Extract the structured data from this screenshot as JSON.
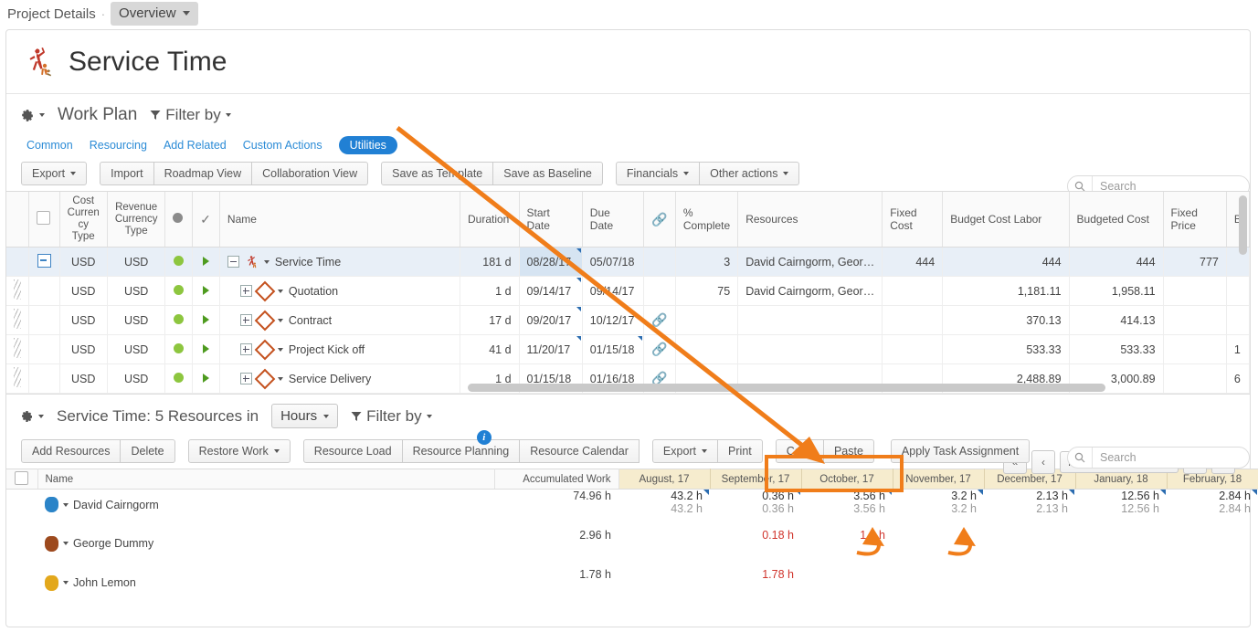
{
  "breadcrumb": {
    "root": "Project Details",
    "sep": "·",
    "current": "Overview"
  },
  "page_title": "Service Time",
  "workplan": {
    "title": "Work Plan",
    "filter_label": "Filter by",
    "tabs": [
      {
        "label": "Common",
        "selected": false
      },
      {
        "label": "Resourcing",
        "selected": false
      },
      {
        "label": "Add Related",
        "selected": false
      },
      {
        "label": "Custom Actions",
        "selected": false
      },
      {
        "label": "Utilities",
        "selected": true
      }
    ],
    "buttons_group1": [
      "Export"
    ],
    "buttons_group2": [
      "Import",
      "Roadmap View",
      "Collaboration View"
    ],
    "buttons_group3": [
      "Save as Template",
      "Save as Baseline"
    ],
    "buttons_group4": [
      "Financials",
      "Other actions"
    ],
    "search_placeholder": "Search",
    "search_value": ""
  },
  "grid": {
    "columns": [
      "Cost Currency Type",
      "Revenue Currency Type",
      "Name",
      "Duration",
      "Start Date",
      "Due Date",
      "% Complete",
      "Resources",
      "Fixed Cost",
      "Budget Cost Labor",
      "Budgeted Cost",
      "Fixed Price"
    ],
    "col_cost_line1": "Cost",
    "col_cost_line2": "Curren",
    "col_cost_line3": "cy",
    "col_cost_line4": "Type",
    "col_rev_line1": "Revenue",
    "col_rev_line2": "Currency",
    "col_rev_line3": "Type",
    "rows": [
      {
        "cost_currency": "USD",
        "revenue_currency": "USD",
        "name": "Service Time",
        "icon": "runner-icon",
        "expander": "minus",
        "duration": "181 d",
        "start_date": "08/28/17",
        "due_date": "05/07/18",
        "link": false,
        "percent_complete": "3",
        "resources": "David Cairngorm, Geor…",
        "fixed_cost": "444",
        "budget_cost_labor": "444",
        "budgeted_cost": "444",
        "fixed_price": "777",
        "selected": true
      },
      {
        "cost_currency": "USD",
        "revenue_currency": "USD",
        "name": "Quotation",
        "icon": "diamond-icon",
        "expander": "plus",
        "duration": "1 d",
        "start_date": "09/14/17",
        "due_date": "09/14/17",
        "link": false,
        "percent_complete": "75",
        "resources": "David Cairngorm, Geor…",
        "fixed_cost": "",
        "budget_cost_labor": "1,181.11",
        "budgeted_cost": "1,958.11",
        "fixed_price": "",
        "selected": false
      },
      {
        "cost_currency": "USD",
        "revenue_currency": "USD",
        "name": "Contract",
        "icon": "diamond-icon",
        "expander": "plus",
        "duration": "17 d",
        "start_date": "09/20/17",
        "due_date": "10/12/17",
        "link": true,
        "percent_complete": "",
        "resources": "",
        "fixed_cost": "",
        "budget_cost_labor": "370.13",
        "budgeted_cost": "414.13",
        "fixed_price": "",
        "selected": false
      },
      {
        "cost_currency": "USD",
        "revenue_currency": "USD",
        "name": "Project Kick off",
        "icon": "diamond-icon",
        "expander": "plus",
        "duration": "41 d",
        "start_date": "11/20/17",
        "due_date": "01/15/18",
        "link": true,
        "percent_complete": "",
        "resources": "",
        "fixed_cost": "",
        "budget_cost_labor": "533.33",
        "budgeted_cost": "533.33",
        "fixed_price": "",
        "selected": false
      },
      {
        "cost_currency": "USD",
        "revenue_currency": "USD",
        "name": "Service Delivery",
        "icon": "diamond-icon",
        "expander": "plus",
        "duration": "1 d",
        "start_date": "01/15/18",
        "due_date": "01/16/18",
        "link": true,
        "percent_complete": "",
        "resources": "",
        "fixed_cost": "",
        "budget_cost_labor": "2,488.89",
        "budgeted_cost": "3,000.89",
        "fixed_price": "",
        "selected": false
      }
    ]
  },
  "resources": {
    "title": "Service Time: 5 Resources in",
    "unit": "Hours",
    "filter_label": "Filter by",
    "nav_first": "«",
    "nav_prev": "‹",
    "nav_next": "›",
    "nav_last": "»",
    "scale": "Month",
    "buttons_group1": [
      "Add Resources",
      "Delete"
    ],
    "buttons_group2": [
      "Restore Work"
    ],
    "buttons_group3": [
      "Resource Load",
      "Resource Planning",
      "Resource Calendar"
    ],
    "buttons_group4": [
      "Export",
      "Print"
    ],
    "buttons_group5": [
      "Copy",
      "Paste"
    ],
    "highlighted_button": "Apply Task Assignment",
    "search_placeholder": "Search",
    "search_value": "",
    "col_name": "Name",
    "col_accumulated": "Accumulated Work",
    "months": [
      "August, 17",
      "September, 17",
      "October, 17",
      "November, 17",
      "December, 17",
      "January, 18",
      "February, 18"
    ],
    "rows": [
      {
        "name": "David Cairngorm",
        "avatar_color": "#2b84c8",
        "accumulated": "74.96 h",
        "cells": [
          {
            "top": "43.2 h",
            "bottom": "43.2 h",
            "style": "normal"
          },
          {
            "top": "0.36 h",
            "bottom": "0.36 h",
            "style": "normal"
          },
          {
            "top": "3.56 h",
            "bottom": "3.56 h",
            "style": "normal"
          },
          {
            "top": "3.2 h",
            "bottom": "3.2 h",
            "style": "normal"
          },
          {
            "top": "2.13 h",
            "bottom": "2.13 h",
            "style": "normal"
          },
          {
            "top": "12.56 h",
            "bottom": "12.56 h",
            "style": "normal"
          },
          {
            "top": "2.84 h",
            "bottom": "2.84 h",
            "style": "normal"
          }
        ]
      },
      {
        "name": "George Dummy",
        "avatar_color": "#9d4a1e",
        "accumulated": "2.96 h",
        "cells": [
          {
            "top": "",
            "bottom": "",
            "style": "none"
          },
          {
            "top": "0.18 h",
            "bottom": "",
            "style": "red"
          },
          {
            "top": "1.6 h",
            "bottom": "",
            "style": "red"
          },
          {
            "top": "",
            "bottom": "",
            "style": "none"
          },
          {
            "top": "",
            "bottom": "",
            "style": "none"
          },
          {
            "top": "",
            "bottom": "",
            "style": "none"
          },
          {
            "top": "",
            "bottom": "",
            "style": "none"
          }
        ]
      },
      {
        "name": "John Lemon",
        "avatar_color": "#e3a81c",
        "accumulated": "1.78 h",
        "cells": [
          {
            "top": "",
            "bottom": "",
            "style": "none"
          },
          {
            "top": "1.78 h",
            "bottom": "",
            "style": "red"
          },
          {
            "top": "",
            "bottom": "",
            "style": "none"
          },
          {
            "top": "",
            "bottom": "",
            "style": "none"
          },
          {
            "top": "",
            "bottom": "",
            "style": "none"
          },
          {
            "top": "",
            "bottom": "",
            "style": "none"
          },
          {
            "top": "",
            "bottom": "",
            "style": "none"
          }
        ]
      }
    ]
  },
  "annotation": {
    "color": "#f07d1a"
  }
}
